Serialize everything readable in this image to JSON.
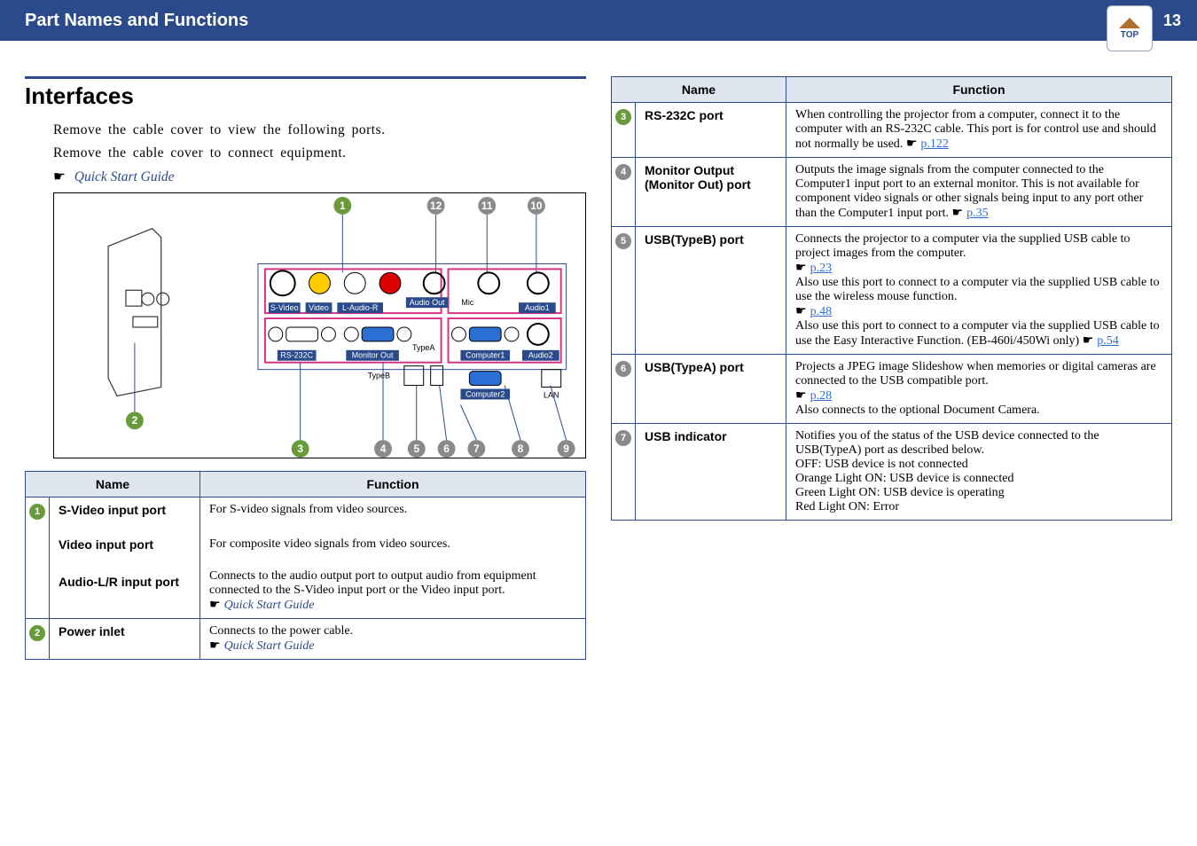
{
  "header": {
    "title": "Part Names and Functions",
    "page_number": "13",
    "logo_label": "TOP"
  },
  "section": {
    "heading": "Interfaces",
    "line1": "Remove the cable cover to view the following ports.",
    "line2": "Remove the cable cover to connect equipment.",
    "quick_guide": "Quick Start Guide"
  },
  "diagram": {
    "labels": {
      "svideo": "S-Video",
      "video": "Video",
      "laudior": "L-Audio-R",
      "audioout": "Audio Out",
      "mic": "Mic",
      "audio1": "Audio1",
      "audio2": "Audio2",
      "rs232c": "RS-232C",
      "monitorout": "Monitor Out",
      "typea": "TypeA",
      "typeb": "TypeB",
      "computer1": "Computer1",
      "computer2": "Computer2",
      "lan": "LAN"
    }
  },
  "table_headers": {
    "name": "Name",
    "function": "Function"
  },
  "left_table": [
    {
      "num": "1",
      "color": "c-green",
      "name": "S-Video input port",
      "func": "For S-video signals from video sources."
    },
    {
      "num": "",
      "name": "Video input port",
      "func": "For composite video signals from video sources."
    },
    {
      "num": "",
      "name": "Audio-L/R input port",
      "func_lines": [
        "Connects to the audio output port to output audio from equipment connected to the S-Video input port or the Video input port."
      ],
      "qsg": "Quick Start Guide"
    },
    {
      "num": "2",
      "color": "c-green",
      "name": "Power inlet",
      "func": "Connects to the power cable.",
      "qsg": "Quick Start Guide"
    }
  ],
  "right_table": [
    {
      "num": "3",
      "color": "c-green",
      "name": "RS-232C port",
      "func": "When controlling the projector from a computer, connect it to the computer with an RS-232C cable. This port is for control use and should not normally be used.",
      "link": "p.122"
    },
    {
      "num": "4",
      "color": "c-gray",
      "name_line1": "Monitor Output",
      "name_line2": "(Monitor Out) port",
      "func": "Outputs the image signals from the computer connected to the Computer1 input port to an external monitor. This is not available for component video signals or other signals being input to any port other than the Computer1 input port.",
      "link": "p.35"
    },
    {
      "num": "5",
      "color": "c-gray",
      "name": "USB(TypeB) port",
      "blocks": [
        {
          "text": "Connects the projector to a computer via the supplied USB cable to project images from the computer.",
          "link": "p.23"
        },
        {
          "text": "Also use this port to connect to a computer via the supplied USB cable to use the wireless mouse function.",
          "link": "p.48"
        },
        {
          "text": "Also use this port to connect to a computer via the supplied USB cable to use the Easy Interactive Function. (EB-460i/450Wi only)",
          "link": "p.54"
        }
      ]
    },
    {
      "num": "6",
      "color": "c-gray",
      "name": "USB(TypeA) port",
      "func": "Projects a JPEG image Slideshow when memories or digital cameras are connected to the USB compatible port.",
      "link": "p.28",
      "extra": "Also connects to the optional Document Camera."
    },
    {
      "num": "7",
      "color": "c-gray",
      "name": "USB indicator",
      "func": "Notifies you of the status of the USB device connected to the USB(TypeA) port as described below.",
      "status_lines": [
        "OFF: USB device is not connected",
        "Orange Light ON: USB device is connected",
        "Green Light ON: USB device is operating",
        "Red Light ON: Error"
      ]
    }
  ]
}
